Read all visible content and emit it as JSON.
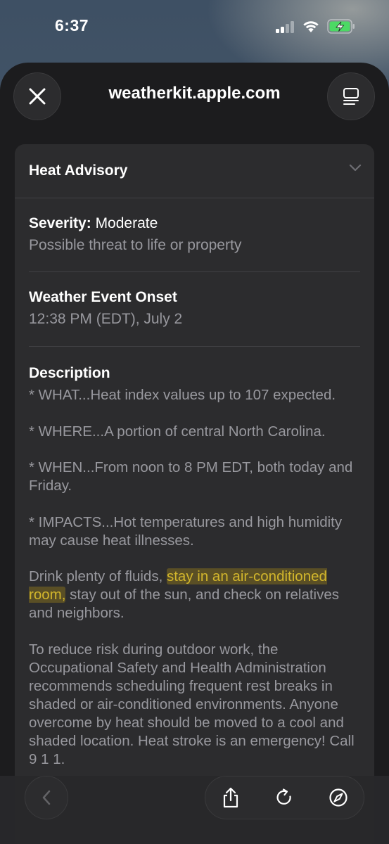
{
  "status_bar": {
    "time": "6:37"
  },
  "sheet": {
    "url": "weatherkit.apple.com",
    "close_icon": "close-icon",
    "reader_icon": "reader-icon"
  },
  "alert": {
    "title": "Heat Advisory",
    "severity_label": "Severity:",
    "severity_value": "Moderate",
    "severity_note": "Possible threat to life or property",
    "onset_label": "Weather Event Onset",
    "onset_value": "12:38 PM (EDT), July 2",
    "description_label": "Description",
    "what": "* WHAT...Heat index values up to 107 expected.",
    "where": "* WHERE...A portion of central North Carolina.",
    "when": "* WHEN...From noon to 8 PM EDT, both today and Friday.",
    "impacts": "* IMPACTS...Hot temperatures and high humidity may cause heat illnesses.",
    "advice_before": "Drink plenty of fluids, ",
    "advice_highlight": "stay in an air-conditioned room,",
    "advice_after": " stay out of the sun, and check on relatives and neighbors.",
    "osha": "To reduce risk during outdoor work, the Occupational Safety and Health Administration recommends scheduling frequent rest breaks in shaded or air-conditioned environments. Anyone overcome by heat should be moved to a cool and shaded location. Heat stroke is an emergency! Call 9 1 1."
  },
  "toolbar": {
    "icons": [
      "back-icon",
      "share-icon",
      "reload-icon",
      "compass-icon"
    ]
  },
  "colors": {
    "background": "#1c1c1e",
    "card": "#2c2c2e",
    "secondary_text": "#98989e",
    "highlight": "#d2b62c"
  }
}
